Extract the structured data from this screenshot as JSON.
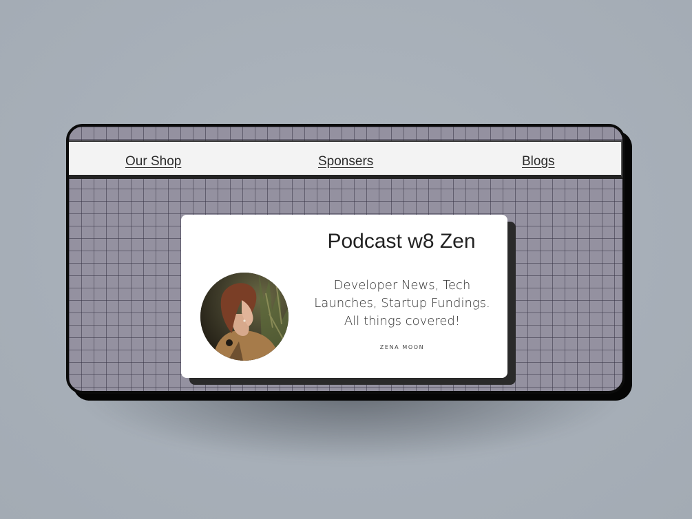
{
  "nav": {
    "items": [
      {
        "label": "Our Shop"
      },
      {
        "label": "Sponsers"
      },
      {
        "label": "Blogs"
      }
    ]
  },
  "card": {
    "title": "Podcast w8 Zen",
    "description": "Developer News, Tech Launches, Startup Fundings. All things covered!",
    "author": "ZENA MOON",
    "avatar_icon": "person-portrait-icon"
  },
  "colors": {
    "page_bg": "#a7afb8",
    "grid_bg": "#9491a0",
    "frame_border": "#0b0b0b",
    "nav_bg": "#f3f3f3",
    "card_bg": "#ffffff",
    "card_shadow": "#2a2a2a"
  }
}
